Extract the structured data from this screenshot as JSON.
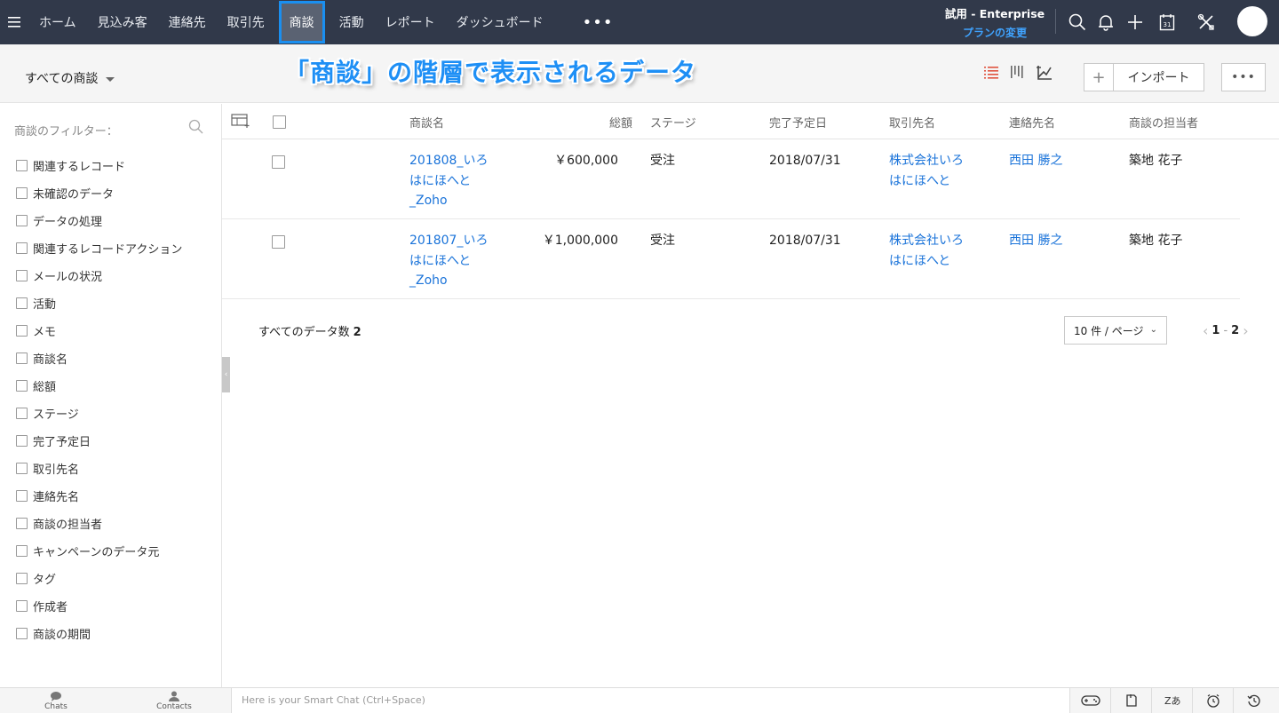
{
  "nav": {
    "items": [
      "ホーム",
      "見込み客",
      "連絡先",
      "取引先",
      "商談",
      "活動",
      "レポート",
      "ダッシュボード"
    ],
    "active_index": 4,
    "more": "•••",
    "trial_label": "試用 - Enterprise",
    "plan_change": "プランの変更"
  },
  "subheader": {
    "view_name": "すべての商談",
    "banner": "「商談」の階層で表示されるデータ",
    "plus": "+",
    "import": "インポート",
    "more": "•••"
  },
  "sidebar": {
    "filter_title": "商談のフィルター：",
    "filters": [
      "関連するレコード",
      "未確認のデータ",
      "データの処理",
      "関連するレコードアクション",
      "メールの状況",
      "活動",
      "メモ",
      "商談名",
      "総額",
      "ステージ",
      "完了予定日",
      "取引先名",
      "連絡先名",
      "商談の担当者",
      "キャンペーンのデータ元",
      "タグ",
      "作成者",
      "商談の期間"
    ]
  },
  "table": {
    "columns": {
      "name": "商談名",
      "amount": "総額",
      "stage": "ステージ",
      "date": "完了予定日",
      "account": "取引先名",
      "contact": "連絡先名",
      "owner": "商談の担当者"
    },
    "rows": [
      {
        "name_l1": "201808_いろ",
        "name_l2": "はにほへと",
        "name_l3": "_Zoho",
        "amount": "￥600,000",
        "stage": "受注",
        "date": "2018/07/31",
        "account_l1": "株式会社いろ",
        "account_l2": "はにほへと",
        "contact": "西田 勝之",
        "owner": "築地 花子"
      },
      {
        "name_l1": "201807_いろ",
        "name_l2": "はにほへと",
        "name_l3": "_Zoho",
        "amount": "￥1,000,000",
        "stage": "受注",
        "date": "2018/07/31",
        "account_l1": "株式会社いろ",
        "account_l2": "はにほへと",
        "contact": "西田 勝之",
        "owner": "築地 花子"
      }
    ],
    "total_label": "すべてのデータ数",
    "total_count": "2",
    "per_page": "10 件 / ページ",
    "page_from": "1",
    "page_sep": "-",
    "page_to": "2"
  },
  "bottombar": {
    "chats": "Chats",
    "contacts": "Contacts",
    "smartchat_placeholder": "Here is your Smart Chat (Ctrl+Space)"
  },
  "colors": {
    "nav_bg": "#31394a",
    "accent": "#1a8ff0",
    "link": "#1a73d9",
    "banner": "#1e8ff5"
  }
}
